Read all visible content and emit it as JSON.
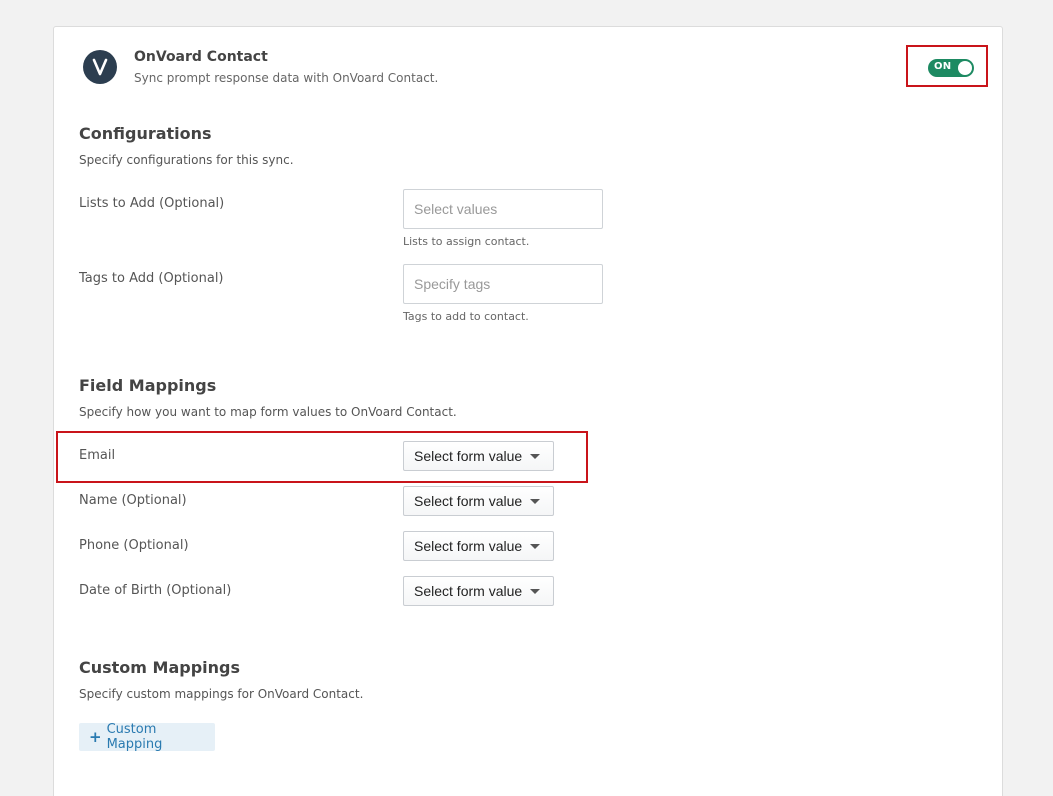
{
  "header": {
    "title": "OnVoard Contact",
    "subtitle": "Sync prompt response data with OnVoard Contact.",
    "toggle_label": "ON",
    "accent_color": "#1d8a62"
  },
  "configurations": {
    "title": "Configurations",
    "description": "Specify configurations for this sync.",
    "lists": {
      "label": "Lists to Add (Optional)",
      "placeholder": "Select values",
      "hint": "Lists to assign contact."
    },
    "tags": {
      "label": "Tags to Add (Optional)",
      "placeholder": "Specify tags",
      "hint": "Tags to add to contact."
    }
  },
  "field_mappings": {
    "title": "Field Mappings",
    "description": "Specify how you want to map form values to OnVoard Contact.",
    "rows": [
      {
        "label": "Email",
        "select": "Select form value"
      },
      {
        "label": "Name (Optional)",
        "select": "Select form value"
      },
      {
        "label": "Phone (Optional)",
        "select": "Select form value"
      },
      {
        "label": "Date of Birth (Optional)",
        "select": "Select form value"
      }
    ]
  },
  "custom_mappings": {
    "title": "Custom Mappings",
    "description": "Specify custom mappings for OnVoard Contact.",
    "button_label": "Custom Mapping",
    "button_icon": "plus-icon"
  }
}
